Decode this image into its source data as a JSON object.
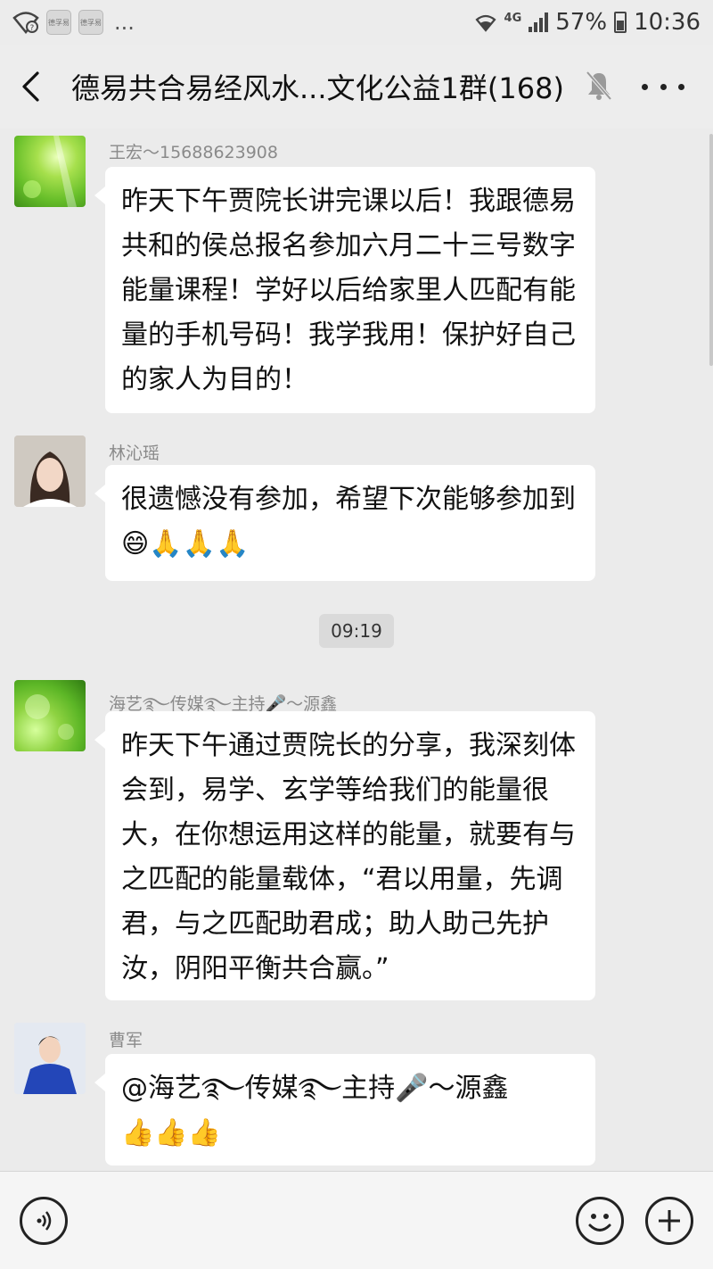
{
  "status_bar": {
    "app_icon_1": "德孚易",
    "app_icon_2": "德孚易",
    "more": "...",
    "network": "4G",
    "battery": "57%",
    "time": "10:36"
  },
  "header": {
    "title": "德易共合易经风水...文化公益1群(168)",
    "icons": [
      "back-arrow-icon",
      "mute-bell-icon",
      "more-icon"
    ]
  },
  "messages": [
    {
      "sender": "王宏～15688623908",
      "text": "昨天下午贾院长讲完课以后！我跟德易共和的侯总报名参加六月二十三号数字能量课程！学好以后给家里人匹配有能量的手机号码！我学我用！保护好自己的家人为目的！"
    },
    {
      "sender": "林沁瑶",
      "text": "很遗憾没有参加，希望下次能够参加到",
      "emojis": "😄🙏🙏🙏"
    },
    {
      "sender": "海艺࿐传媒࿐主持🎤～源鑫",
      "text": "昨天下午通过贾院长的分享，我深刻体会到，易学、玄学等给我们的能量很大，在你想运用这样的能量，就要有与之匹配的能量载体，“君以用量，先调君，与之匹配助君成；助人助己先护汝，阴阳平衡共合赢。”"
    },
    {
      "sender": "曹军",
      "mention": "@海艺࿐传媒࿐主持🎤～源鑫",
      "emojis": "👍👍👍"
    }
  ],
  "timestamp": "09:19",
  "input_bar": {
    "placeholder": "",
    "icons": [
      "voice-icon",
      "emoji-icon",
      "plus-icon"
    ]
  },
  "colors": {
    "background": "#ebebeb",
    "bubble": "#ffffff",
    "sender_text": "#8a8a8a"
  }
}
